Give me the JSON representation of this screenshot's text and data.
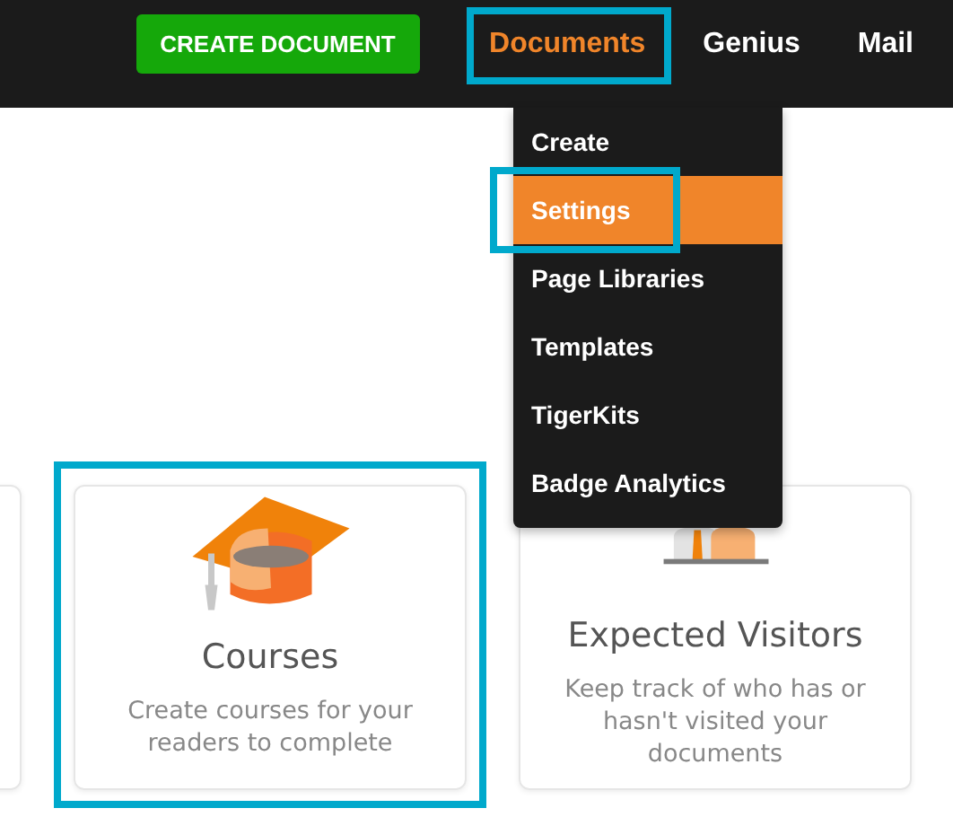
{
  "create_button": {
    "label": "CREATE DOCUMENT"
  },
  "nav": [
    {
      "label": "Documents",
      "selected": true,
      "highlighted": true
    },
    {
      "label": "Genius",
      "selected": false,
      "highlighted": false
    },
    {
      "label": "Mail",
      "selected": false,
      "highlighted": false
    }
  ],
  "dropdown": [
    {
      "label": "Create",
      "selected": false,
      "highlighted": false
    },
    {
      "label": "Settings",
      "selected": true,
      "highlighted": true
    },
    {
      "label": "Page Libraries",
      "selected": false,
      "highlighted": false
    },
    {
      "label": "Templates",
      "selected": false,
      "highlighted": false
    },
    {
      "label": "TigerKits",
      "selected": false,
      "highlighted": false
    },
    {
      "label": "Badge Analytics",
      "selected": false,
      "highlighted": false
    }
  ],
  "cards": [
    {
      "kind": "courses",
      "title": "Courses",
      "description": "Create courses for your readers to complete",
      "highlighted": true
    },
    {
      "kind": "visitors",
      "title": "Expected Visitors",
      "description": "Keep track of who has or hasn't visited your documents",
      "highlighted": false
    }
  ]
}
